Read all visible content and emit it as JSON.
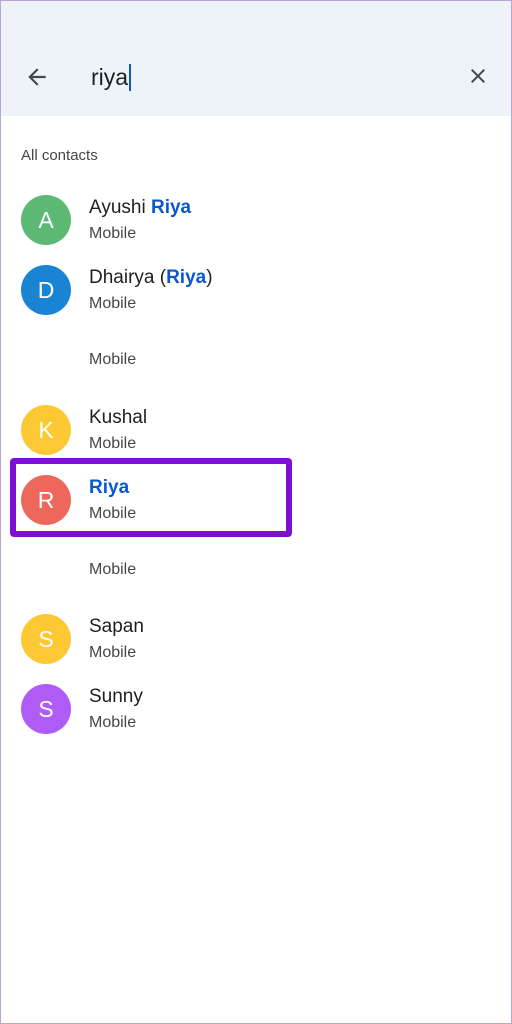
{
  "search": {
    "query": "riya",
    "back_icon": "arrow-back-icon",
    "clear_icon": "close-icon"
  },
  "section": {
    "label": "All contacts"
  },
  "contacts": [
    {
      "initial": "A",
      "name_prefix": "Ayushi ",
      "name_match": "Riya",
      "name_suffix": "",
      "subtitle": "Mobile",
      "avatar_color": "#5bb974"
    },
    {
      "initial": "D",
      "name_prefix": "Dhairya (",
      "name_match": "Riya",
      "name_suffix": ")",
      "subtitle": "Mobile",
      "avatar_color": "#1a84d4"
    },
    {
      "initial": "",
      "name_prefix": "",
      "name_match": "",
      "name_suffix": "",
      "subtitle": "Mobile",
      "avatar_color": ""
    },
    {
      "initial": "K",
      "name_prefix": "Kushal",
      "name_match": "",
      "name_suffix": "",
      "subtitle": "Mobile",
      "avatar_color": "#fcc934"
    },
    {
      "initial": "R",
      "name_prefix": "",
      "name_match": "Riya",
      "name_suffix": "",
      "subtitle": "Mobile",
      "avatar_color": "#ee675c"
    },
    {
      "initial": "",
      "name_prefix": "",
      "name_match": "",
      "name_suffix": "",
      "subtitle": "Mobile",
      "avatar_color": ""
    },
    {
      "initial": "S",
      "name_prefix": "Sapan",
      "name_match": "",
      "name_suffix": "",
      "subtitle": "Mobile",
      "avatar_color": "#fcc934"
    },
    {
      "initial": "S",
      "name_prefix": "Sunny",
      "name_match": "",
      "name_suffix": "",
      "subtitle": "Mobile",
      "avatar_color": "#af5cf7"
    }
  ],
  "colors": {
    "header_bg": "#eef2f9",
    "match_highlight": "#0b57d0",
    "annotation_box": "#7e0fd2"
  }
}
